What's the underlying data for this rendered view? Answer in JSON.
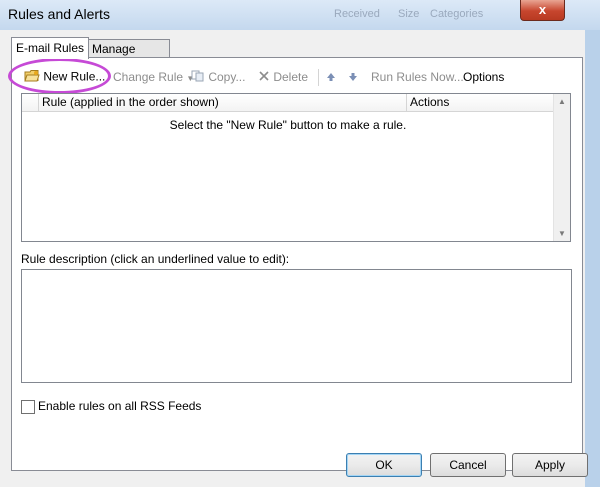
{
  "window": {
    "title": "Rules and Alerts",
    "close_glyph": "x",
    "background_ghost": [
      "Received",
      "Size",
      "Categories"
    ]
  },
  "tabs": [
    {
      "label": "E-mail Rules",
      "active": true
    },
    {
      "label": "Manage Alerts",
      "active": false
    }
  ],
  "toolbar": {
    "new_rule": "New Rule...",
    "change_rule": "Change Rule",
    "copy": "Copy...",
    "delete": "Delete",
    "move_up_icon": "arrow-up-icon",
    "move_down_icon": "arrow-down-icon",
    "run_rules_now": "Run Rules Now...",
    "options": "Options"
  },
  "rules_table": {
    "columns": [
      "Rule (applied in the order shown)",
      "Actions"
    ],
    "empty_message": "Select the \"New Rule\" button to make a rule."
  },
  "rule_description": {
    "label": "Rule description (click an underlined value to edit):"
  },
  "rss": {
    "label": "Enable rules on all RSS Feeds",
    "checked": false
  },
  "buttons": {
    "ok": "OK",
    "cancel": "Cancel",
    "apply": "Apply"
  },
  "colors": {
    "highlight": "#c64ad6",
    "close_button": "#c7462e",
    "window_frame": "#b9d1ea"
  }
}
